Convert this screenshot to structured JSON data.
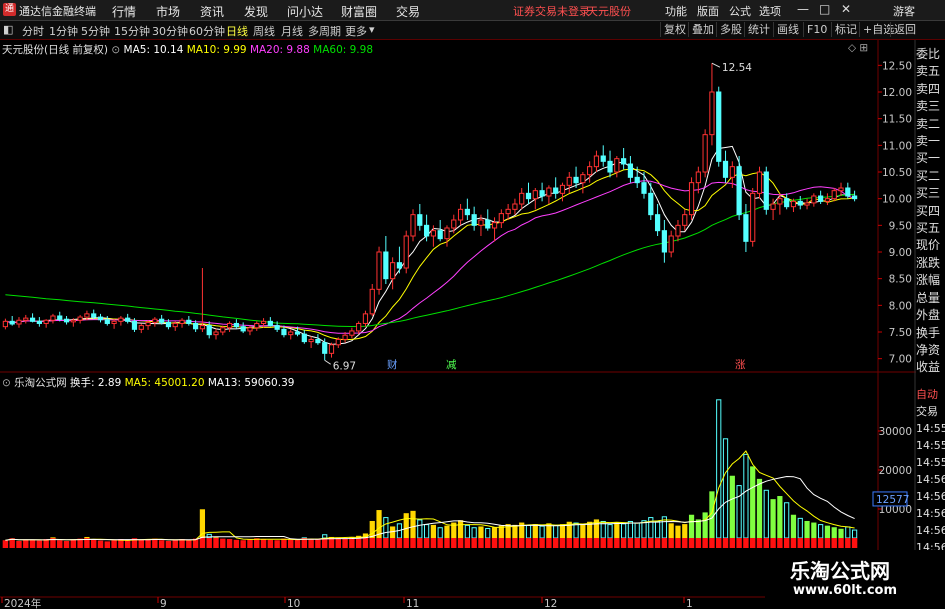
{
  "app": {
    "name": "通达信金融终端",
    "logo_char": "通"
  },
  "menu": [
    "行情",
    "市场",
    "资讯",
    "发现",
    "问小达",
    "财富圈",
    "交易"
  ],
  "warning": "证券交易未登录",
  "stock_name": "天元股份",
  "right_menu": [
    "功能",
    "版面",
    "公式",
    "选项"
  ],
  "window_buttons": {
    "min": "—",
    "max": "□",
    "close": "✕",
    "guest": "游客"
  },
  "periods": [
    "分时",
    "1分钟",
    "5分钟",
    "15分钟",
    "30分钟",
    "60分钟",
    "日线",
    "周线",
    "月线",
    "多周期",
    "更多"
  ],
  "active_period": "日线",
  "toolbar_right": [
    "复权",
    "叠加",
    "多股",
    "统计",
    "画线",
    "F10",
    "标记",
    "+自选",
    "返回"
  ],
  "main_legend": {
    "title": "天元股份(日线 前复权)",
    "ma5": "MA5: 10.14",
    "ma10": "MA10: 9.99",
    "ma20": "MA20: 9.88",
    "ma60": "MA60: 9.98"
  },
  "vol_legend": {
    "title": "乐淘公式网",
    "turnover": "换手: 2.89",
    "ma5": "MA5: 45001.20",
    "ma13": "MA13: 59060.39"
  },
  "price_labels": {
    "high": "12.54",
    "low": "6.97"
  },
  "event_tags": [
    "财",
    "减",
    "涨"
  ],
  "sidebar_top": [
    "委比",
    "卖五",
    "卖四",
    "卖三",
    "卖二",
    "卖一",
    "买一",
    "买二",
    "买三",
    "买四",
    "买五",
    "现价",
    "涨跌",
    "涨幅",
    "总量",
    "外盘",
    "换手",
    "净资",
    "收益"
  ],
  "sidebar_bottom": [
    "自动",
    "交易",
    "14:55",
    "14:55",
    "14:55",
    "14:56",
    "14:56",
    "14:56",
    "14:56",
    "14:56"
  ],
  "vol_current": "12577",
  "date_labels": [
    "2024年",
    "9",
    "10",
    "11",
    "12",
    "1"
  ],
  "watermark": {
    "cn": "乐淘公式网",
    "url": "www.60lt.com"
  },
  "colors": {
    "up": "#ff3232",
    "down": "#54ffff",
    "ma5": "#ffffff",
    "ma10": "#ffff00",
    "ma20": "#ff40ff",
    "ma60": "#00e000",
    "grid": "#700000"
  },
  "chart_data": {
    "type": "candlestick",
    "price_axis": {
      "min": 7.0,
      "max": 12.5,
      "ticks": [
        7.0,
        7.5,
        8.0,
        8.5,
        9.0,
        9.5,
        10.0,
        10.5,
        11.0,
        11.5,
        12.0,
        12.5
      ]
    },
    "volume_axis": {
      "ticks": [
        10000,
        20000,
        30000
      ]
    },
    "ohlc": [
      [
        7.6,
        7.75,
        7.55,
        7.7
      ],
      [
        7.7,
        7.8,
        7.62,
        7.65
      ],
      [
        7.65,
        7.78,
        7.58,
        7.72
      ],
      [
        7.72,
        7.82,
        7.66,
        7.76
      ],
      [
        7.76,
        7.85,
        7.68,
        7.7
      ],
      [
        7.7,
        7.78,
        7.6,
        7.66
      ],
      [
        7.66,
        7.74,
        7.58,
        7.72
      ],
      [
        7.72,
        7.84,
        7.66,
        7.8
      ],
      [
        7.8,
        7.88,
        7.7,
        7.74
      ],
      [
        7.74,
        7.8,
        7.64,
        7.69
      ],
      [
        7.69,
        7.76,
        7.6,
        7.72
      ],
      [
        7.72,
        7.82,
        7.66,
        7.78
      ],
      [
        7.78,
        7.9,
        7.72,
        7.84
      ],
      [
        7.84,
        7.92,
        7.74,
        7.78
      ],
      [
        7.78,
        7.84,
        7.68,
        7.73
      ],
      [
        7.73,
        7.8,
        7.62,
        7.66
      ],
      [
        7.66,
        7.74,
        7.56,
        7.7
      ],
      [
        7.7,
        7.8,
        7.62,
        7.76
      ],
      [
        7.76,
        7.84,
        7.66,
        7.7
      ],
      [
        7.7,
        7.76,
        7.5,
        7.55
      ],
      [
        7.55,
        7.66,
        7.48,
        7.62
      ],
      [
        7.62,
        7.72,
        7.54,
        7.68
      ],
      [
        7.68,
        7.78,
        7.6,
        7.74
      ],
      [
        7.74,
        7.82,
        7.64,
        7.68
      ],
      [
        7.68,
        7.74,
        7.55,
        7.6
      ],
      [
        7.6,
        7.7,
        7.52,
        7.66
      ],
      [
        7.66,
        7.76,
        7.58,
        7.72
      ],
      [
        7.72,
        7.8,
        7.62,
        7.66
      ],
      [
        7.66,
        7.72,
        7.5,
        7.56
      ],
      [
        7.56,
        8.7,
        7.5,
        7.62
      ],
      [
        7.62,
        7.7,
        7.38,
        7.45
      ],
      [
        7.45,
        7.56,
        7.36,
        7.5
      ],
      [
        7.5,
        7.62,
        7.44,
        7.58
      ],
      [
        7.58,
        7.7,
        7.5,
        7.66
      ],
      [
        7.66,
        7.74,
        7.56,
        7.6
      ],
      [
        7.6,
        7.68,
        7.48,
        7.52
      ],
      [
        7.52,
        7.62,
        7.44,
        7.58
      ],
      [
        7.58,
        7.7,
        7.52,
        7.66
      ],
      [
        7.66,
        7.76,
        7.58,
        7.7
      ],
      [
        7.7,
        7.78,
        7.6,
        7.62
      ],
      [
        7.62,
        7.7,
        7.5,
        7.55
      ],
      [
        7.55,
        7.62,
        7.4,
        7.45
      ],
      [
        7.45,
        7.55,
        7.36,
        7.5
      ],
      [
        7.5,
        7.6,
        7.42,
        7.46
      ],
      [
        7.46,
        7.54,
        7.28,
        7.32
      ],
      [
        7.32,
        7.42,
        7.2,
        7.36
      ],
      [
        7.36,
        7.46,
        7.26,
        7.3
      ],
      [
        7.3,
        7.38,
        6.97,
        7.1
      ],
      [
        7.1,
        7.3,
        7.02,
        7.26
      ],
      [
        7.26,
        7.4,
        7.2,
        7.36
      ],
      [
        7.36,
        7.5,
        7.3,
        7.44
      ],
      [
        7.44,
        7.58,
        7.38,
        7.52
      ],
      [
        7.52,
        7.7,
        7.46,
        7.66
      ],
      [
        7.66,
        7.9,
        7.6,
        7.84
      ],
      [
        7.84,
        8.4,
        7.8,
        8.3
      ],
      [
        8.3,
        9.1,
        8.2,
        9.0
      ],
      [
        9.0,
        9.3,
        8.4,
        8.5
      ],
      [
        8.5,
        8.9,
        8.3,
        8.8
      ],
      [
        8.8,
        9.1,
        8.6,
        8.7
      ],
      [
        8.7,
        9.4,
        8.6,
        9.3
      ],
      [
        9.3,
        9.8,
        9.2,
        9.7
      ],
      [
        9.7,
        9.9,
        9.4,
        9.5
      ],
      [
        9.5,
        9.7,
        9.2,
        9.3
      ],
      [
        9.3,
        9.5,
        9.1,
        9.4
      ],
      [
        9.4,
        9.6,
        9.2,
        9.25
      ],
      [
        9.25,
        9.5,
        9.1,
        9.45
      ],
      [
        9.45,
        9.7,
        9.35,
        9.6
      ],
      [
        9.6,
        9.9,
        9.5,
        9.8
      ],
      [
        9.8,
        10.0,
        9.6,
        9.7
      ],
      [
        9.7,
        9.85,
        9.4,
        9.5
      ],
      [
        9.5,
        9.7,
        9.3,
        9.6
      ],
      [
        9.6,
        9.8,
        9.4,
        9.45
      ],
      [
        9.45,
        9.65,
        9.2,
        9.55
      ],
      [
        9.55,
        9.8,
        9.45,
        9.72
      ],
      [
        9.72,
        9.9,
        9.6,
        9.8
      ],
      [
        9.8,
        10.0,
        9.7,
        9.9
      ],
      [
        9.9,
        10.2,
        9.8,
        10.1
      ],
      [
        10.1,
        10.3,
        9.9,
        10.0
      ],
      [
        10.0,
        10.2,
        9.8,
        10.15
      ],
      [
        10.15,
        10.3,
        9.95,
        10.05
      ],
      [
        10.05,
        10.25,
        9.9,
        10.2
      ],
      [
        10.2,
        10.4,
        10.0,
        10.1
      ],
      [
        10.1,
        10.3,
        9.95,
        10.25
      ],
      [
        10.25,
        10.5,
        10.1,
        10.4
      ],
      [
        10.4,
        10.6,
        10.2,
        10.3
      ],
      [
        10.3,
        10.5,
        10.1,
        10.45
      ],
      [
        10.45,
        10.7,
        10.3,
        10.6
      ],
      [
        10.6,
        10.9,
        10.5,
        10.8
      ],
      [
        10.8,
        11.0,
        10.6,
        10.7
      ],
      [
        10.7,
        10.9,
        10.4,
        10.5
      ],
      [
        10.5,
        10.8,
        10.4,
        10.75
      ],
      [
        10.75,
        10.95,
        10.55,
        10.65
      ],
      [
        10.65,
        10.8,
        10.3,
        10.4
      ],
      [
        10.4,
        10.6,
        10.2,
        10.3
      ],
      [
        10.3,
        10.5,
        10.0,
        10.1
      ],
      [
        10.1,
        10.3,
        9.6,
        9.7
      ],
      [
        9.7,
        9.9,
        9.3,
        9.4
      ],
      [
        9.4,
        9.6,
        8.8,
        9.0
      ],
      [
        9.0,
        9.4,
        8.9,
        9.3
      ],
      [
        9.3,
        9.6,
        9.2,
        9.5
      ],
      [
        9.5,
        9.8,
        9.4,
        9.7
      ],
      [
        9.7,
        10.4,
        9.6,
        10.3
      ],
      [
        10.3,
        10.6,
        10.1,
        10.5
      ],
      [
        10.5,
        11.3,
        10.4,
        11.2
      ],
      [
        11.2,
        12.54,
        11.0,
        12.0
      ],
      [
        12.0,
        12.1,
        10.6,
        10.7
      ],
      [
        10.7,
        10.9,
        10.3,
        10.4
      ],
      [
        10.4,
        10.7,
        10.2,
        10.6
      ],
      [
        10.6,
        10.8,
        9.6,
        9.7
      ],
      [
        9.7,
        9.9,
        9.0,
        9.2
      ],
      [
        9.2,
        10.2,
        9.1,
        10.1
      ],
      [
        10.1,
        10.6,
        10.0,
        10.5
      ],
      [
        10.5,
        10.6,
        9.7,
        9.8
      ],
      [
        9.8,
        10.0,
        9.6,
        9.9
      ],
      [
        9.9,
        10.1,
        9.7,
        10.0
      ],
      [
        10.0,
        10.1,
        9.8,
        9.85
      ],
      [
        9.85,
        10.0,
        9.75,
        9.95
      ],
      [
        9.95,
        10.05,
        9.8,
        9.88
      ],
      [
        9.88,
        10.0,
        9.8,
        9.92
      ],
      [
        9.92,
        10.1,
        9.85,
        10.05
      ],
      [
        10.05,
        10.15,
        9.9,
        9.95
      ],
      [
        9.95,
        10.1,
        9.88,
        10.0
      ],
      [
        10.0,
        10.2,
        9.95,
        10.15
      ],
      [
        10.15,
        10.3,
        10.05,
        10.2
      ],
      [
        10.2,
        10.3,
        10.0,
        10.05
      ],
      [
        10.05,
        10.15,
        9.95,
        10.0
      ]
    ],
    "volume": [
      2000,
      2500,
      1800,
      2200,
      2100,
      1900,
      2300,
      2600,
      2000,
      1800,
      2100,
      2400,
      2700,
      2200,
      1900,
      1700,
      2000,
      2300,
      1900,
      2500,
      2100,
      2200,
      2400,
      2000,
      1800,
      2100,
      2300,
      2000,
      2400,
      9800,
      3500,
      2600,
      2400,
      2300,
      2100,
      2000,
      2200,
      2500,
      2300,
      2100,
      2000,
      2400,
      2200,
      2100,
      2600,
      2300,
      2200,
      3400,
      2700,
      2600,
      2500,
      2700,
      3000,
      3600,
      6800,
      9600,
      7800,
      5400,
      6200,
      8800,
      9400,
      7200,
      6000,
      5800,
      5200,
      5600,
      6400,
      7000,
      5800,
      5200,
      5400,
      5000,
      5200,
      5600,
      6000,
      5800,
      6400,
      5800,
      6000,
      5600,
      6200,
      5800,
      6000,
      6600,
      6400,
      6000,
      6600,
      7200,
      6800,
      6000,
      6400,
      6200,
      6800,
      6400,
      7000,
      7800,
      6800,
      8000,
      6200,
      5600,
      6000,
      8400,
      7200,
      9000,
      14400,
      38000,
      28000,
      18400,
      16000,
      24000,
      20800,
      17600,
      14800,
      12400,
      13200,
      11600,
      8400,
      7600,
      6800,
      6400,
      6000,
      5600,
      5200,
      4800,
      5400,
      4600
    ]
  }
}
